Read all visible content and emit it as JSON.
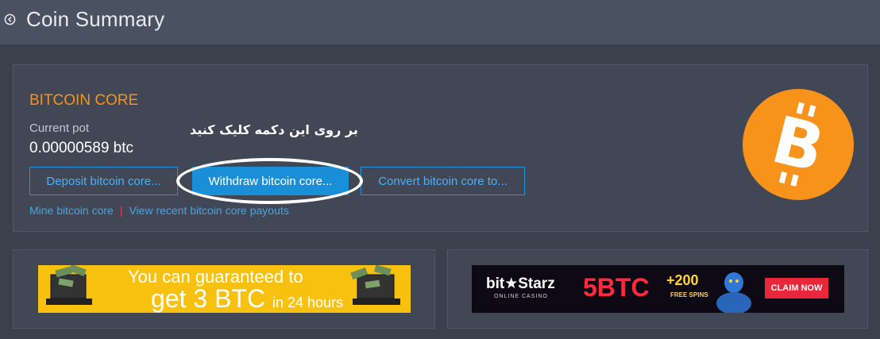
{
  "header": {
    "title": "Coin Summary",
    "back_icon": "back-arrow-icon"
  },
  "coin": {
    "name": "BITCOIN CORE",
    "pot_label": "Current pot",
    "pot_value": "0.00000589 btc",
    "annotation": "بر روی این دکمه کلیک کنید",
    "logo_symbol": "B",
    "logo_color": "#f7931a"
  },
  "actions": {
    "deposit_label": "Deposit bitcoin core...",
    "withdraw_label": "Withdraw bitcoin core...",
    "convert_label": "Convert bitcoin core to..."
  },
  "links": {
    "mine_label": "Mine bitcoin core",
    "separator": "|",
    "payouts_label": "View recent bitcoin core payouts"
  },
  "ads": {
    "left": {
      "line1": "You can guaranteed to",
      "line2": "get 3 BTC",
      "line2_small": "in 24 hours"
    },
    "right": {
      "brand": "bit★Starz",
      "sub": "ONLINE CASINO",
      "promo": "5BTC",
      "plus": "+200",
      "spins": "FREE SPINS",
      "claim": "CLAIM NOW"
    }
  },
  "colors": {
    "accent": "#f7931a",
    "button_blue": "#1a8fd8",
    "link_blue": "#4aa3df",
    "background": "#3a404c"
  }
}
